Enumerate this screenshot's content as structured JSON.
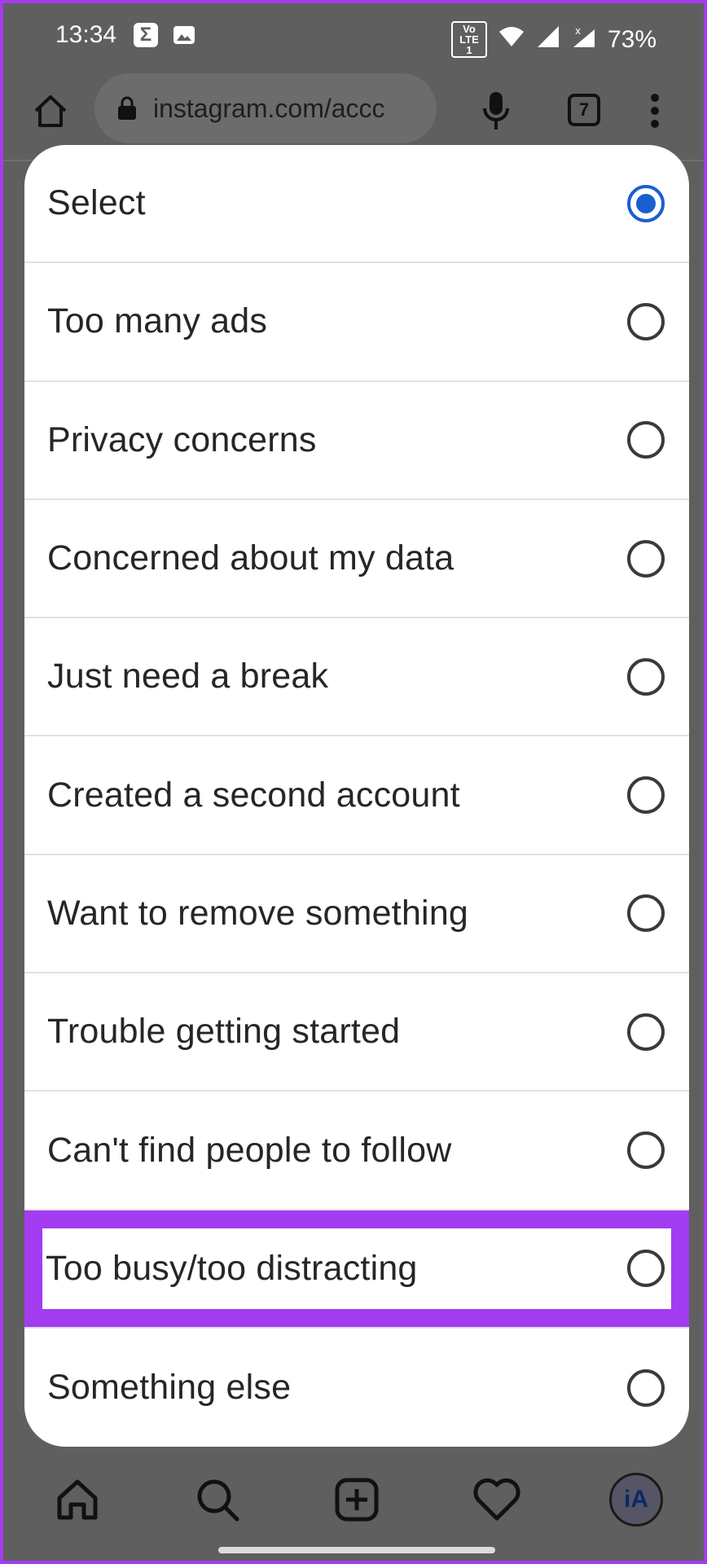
{
  "status_bar": {
    "time": "13:34",
    "sigma_glyph": "Σ",
    "volte_label": "Vo LTE 1",
    "battery": "73%"
  },
  "browser": {
    "url": "instagram.com/accc",
    "tab_count": "7"
  },
  "sheet": {
    "options": [
      {
        "label": "Select",
        "checked": true
      },
      {
        "label": "Too many ads",
        "checked": false
      },
      {
        "label": "Privacy concerns",
        "checked": false
      },
      {
        "label": "Concerned about my data",
        "checked": false
      },
      {
        "label": "Just need a break",
        "checked": false
      },
      {
        "label": "Created a second account",
        "checked": false
      },
      {
        "label": "Want to remove something",
        "checked": false
      },
      {
        "label": "Trouble getting started",
        "checked": false
      },
      {
        "label": "Can't find people to follow",
        "checked": false
      },
      {
        "label": "Too busy/too distracting",
        "checked": false
      },
      {
        "label": "Something else",
        "checked": false
      }
    ]
  },
  "bottom_nav": {
    "avatar_text": "iA"
  },
  "colors": {
    "highlight": "#a23cf0",
    "radio_selected": "#1a5fd0",
    "overlay": "#5f5f5f"
  }
}
